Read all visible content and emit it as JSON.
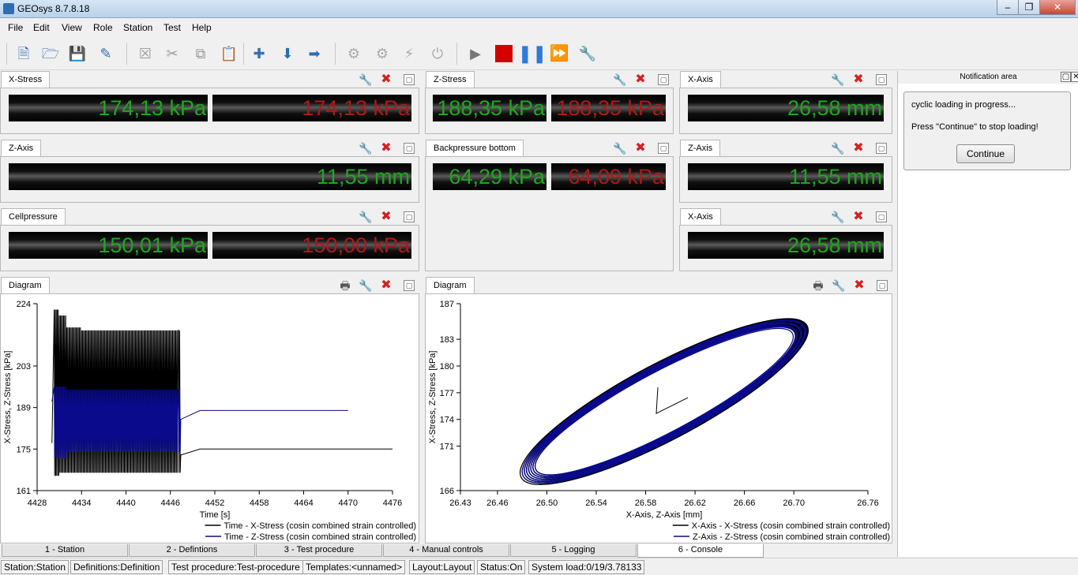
{
  "window": {
    "title": "GEOsys 8.7.8.18"
  },
  "menu": [
    "File",
    "Edit",
    "View",
    "Role",
    "Station",
    "Test",
    "Help"
  ],
  "panels": {
    "x_stress": {
      "label": "X-Stress",
      "value1": "174,13 kPa",
      "value2": "174,13 kPa"
    },
    "z_stress": {
      "label": "Z-Stress",
      "value1": "188,35 kPa",
      "value2": "188,35 kPa"
    },
    "x_axis_1": {
      "label": "X-Axis",
      "value": "26,58 mm"
    },
    "z_axis_1": {
      "label": "Z-Axis",
      "value": "11,55 mm"
    },
    "backpressure": {
      "label": "Backpressure bottom",
      "value1": "64,29 kPa",
      "value2": "64,09 kPa"
    },
    "z_axis_2": {
      "label": "Z-Axis",
      "value": "11,55 mm"
    },
    "cellpressure": {
      "label": "Cellpressure",
      "value1": "150,01 kPa",
      "value2": "150,00 kPa"
    },
    "x_axis_2": {
      "label": "X-Axis",
      "value": "26,58 mm"
    },
    "diagram_left": {
      "label": "Diagram"
    },
    "diagram_right": {
      "label": "Diagram"
    }
  },
  "notification": {
    "title": "Notification area",
    "line1": "cyclic loading in progress...",
    "line2": "Press \"Continue\" to stop loading!",
    "button": "Continue"
  },
  "bottom_tabs": [
    "1 - Station",
    "2 - Defintions",
    "3 - Test procedure",
    "4 - Manual controls",
    "5 - Logging",
    "6 - Console"
  ],
  "status": [
    "Station:Station",
    "Definitions:Definition",
    "Test procedure:Test-procedure",
    "Templates:<unnamed>",
    "Layout:Layout",
    "Status:On",
    "System load:0/19/3.78133"
  ],
  "colors": {
    "lcd_green": "#1ea81e",
    "lcd_red": "#b11818",
    "series_black": "#000000",
    "series_blue": "#0a0a8c"
  },
  "chart_data": [
    {
      "type": "line",
      "xlabel": "Time [s]",
      "ylabel": "X-Stress, Z-Stress [kPa]",
      "xlim": [
        4428,
        4476
      ],
      "ylim": [
        161,
        224
      ],
      "xticks": [
        "4428",
        "4434",
        "4440",
        "4446",
        "4452",
        "4458",
        "4464",
        "4470",
        "4476"
      ],
      "yticks": [
        "161",
        "175",
        "189",
        "203",
        "224"
      ],
      "series": [
        {
          "name": "Time - X-Stress (cosin combined strain controlled)",
          "x": [
            4430.0,
            4430.3,
            4431.0,
            4432.0,
            4434.0,
            4436.0,
            4438.0,
            4440.0,
            4442.0,
            4444.0,
            4446.0,
            4447.1,
            4447.4,
            4450.0,
            4458.0,
            4464.0,
            4470.0,
            4476.0
          ],
          "y_range": [
            [
              177,
              177
            ],
            [
              166,
              222
            ],
            [
              167,
              220
            ],
            [
              167,
              216
            ],
            [
              167,
              215
            ],
            [
              167,
              215
            ],
            [
              167,
              215
            ],
            [
              167,
              215
            ],
            [
              167,
              215
            ],
            [
              167,
              215
            ],
            [
              167,
              215
            ],
            [
              167,
              215
            ],
            [
              173,
              173
            ],
            [
              175,
              175
            ],
            [
              175,
              175
            ],
            [
              175,
              175
            ],
            [
              175,
              175
            ],
            [
              175,
              175
            ]
          ]
        },
        {
          "name": "Time - Z-Stress (cosin combined strain controlled)",
          "x": [
            4430.0,
            4430.3,
            4432.0,
            4434.0,
            4436.0,
            4438.0,
            4440.0,
            4442.0,
            4444.0,
            4446.0,
            4447.1,
            4447.4,
            4450.0,
            4458.0,
            4464.0,
            4470.0
          ],
          "y_range": [
            [
              191,
              191
            ],
            [
              172,
              196
            ],
            [
              174,
              195
            ],
            [
              174,
              195
            ],
            [
              174,
              195
            ],
            [
              174,
              195
            ],
            [
              174,
              195
            ],
            [
              174,
              195
            ],
            [
              174,
              195
            ],
            [
              174,
              195
            ],
            [
              174,
              195
            ],
            [
              185,
              185
            ],
            [
              188,
              188
            ],
            [
              188,
              188
            ],
            [
              188,
              188
            ],
            [
              188,
              188
            ]
          ]
        }
      ]
    },
    {
      "type": "line",
      "xlabel": "X-Axis, Z-Axis [mm]",
      "ylabel": "X-Stress, Z-Stress [kPa]",
      "xlim": [
        26.43,
        26.76
      ],
      "ylim": [
        166,
        187
      ],
      "xticks": [
        "26.43",
        "26.46",
        "26.50",
        "26.54",
        "26.58",
        "26.62",
        "26.66",
        "26.70",
        "26.76"
      ],
      "yticks": [
        "166",
        "171",
        "174",
        "177",
        "180",
        "183",
        "187"
      ],
      "series": [
        {
          "name": "X-Axis - X-Stress (cosin combined strain controlled)",
          "shape": "hysteresis ellipse",
          "x_range": [
            26.48,
            26.71
          ],
          "y_range": [
            166,
            186
          ]
        },
        {
          "name": "Z-Axis - Z-Stress (cosin combined strain controlled)",
          "shape": "hysteresis ellipse",
          "x_range": [
            26.48,
            26.71
          ],
          "y_range": [
            166,
            186
          ]
        }
      ]
    }
  ]
}
